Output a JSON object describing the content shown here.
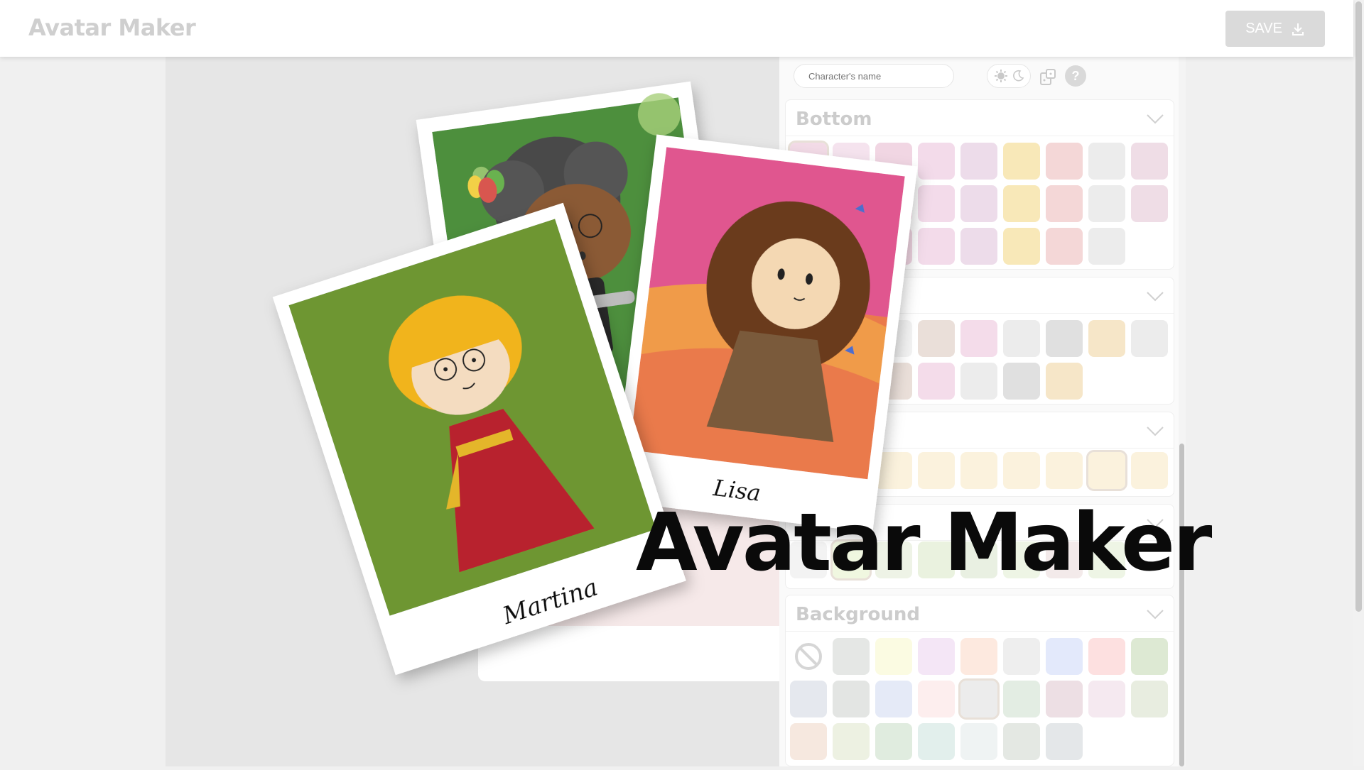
{
  "header": {
    "title": "Avatar Maker",
    "save_label": "SAVE"
  },
  "toolbar": {
    "name_placeholder": "Character's name",
    "help_label": "?",
    "icons": [
      "sun-icon",
      "moon-icon",
      "dice-icon",
      "help-icon"
    ]
  },
  "sections": [
    {
      "title": "Bottom",
      "tile_count": 26,
      "selected_index": 0
    },
    {
      "title": "",
      "tile_count": 16
    },
    {
      "title": "",
      "tile_count": 9,
      "selected_index": 7
    },
    {
      "title": "",
      "tile_count": 8,
      "selected_index": 1
    },
    {
      "title": "Background",
      "tile_count": 25,
      "selected_index": 13
    }
  ],
  "overlay": {
    "title": "Avatar Maker",
    "cards": [
      {
        "name": ""
      },
      {
        "name": "Lisa"
      },
      {
        "name": "Martina"
      }
    ]
  },
  "colors": {
    "stage_bg": "#e6e6e6",
    "panel_bg": "#fafafa",
    "save_bg": "#dadada",
    "title_faded": "#cfcfcf",
    "overlay_text": "#0a0a0a"
  }
}
